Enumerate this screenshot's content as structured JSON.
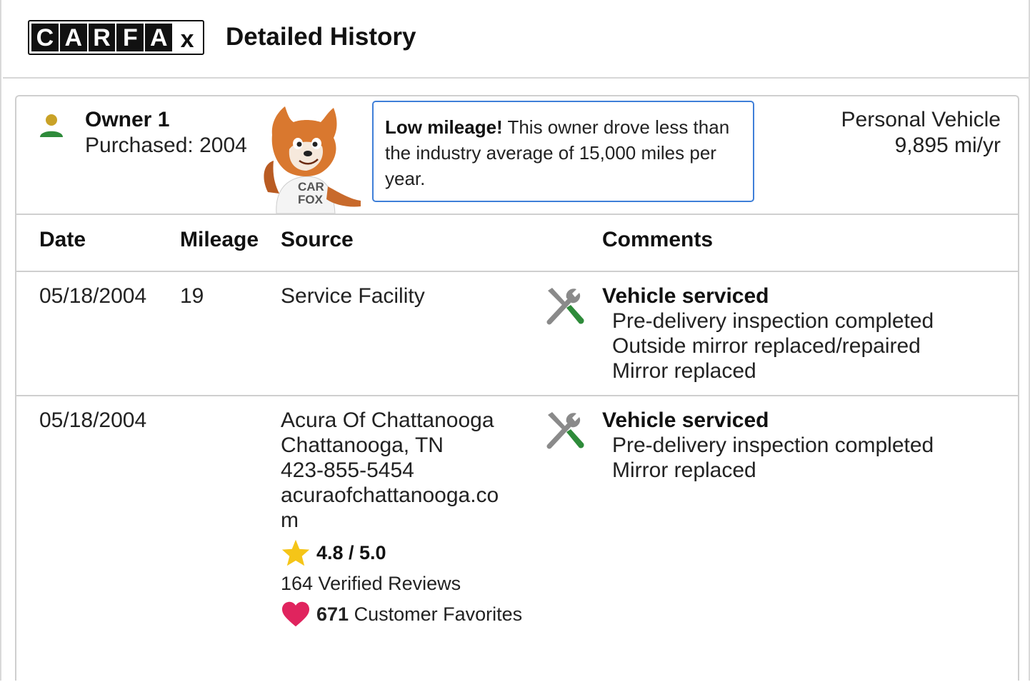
{
  "header": {
    "logo_letters": [
      "C",
      "A",
      "R",
      "F",
      "A",
      "x"
    ],
    "title": "Detailed History"
  },
  "owner": {
    "name": "Owner 1",
    "purchased": "Purchased: 2004",
    "mascot_shirt": [
      "CAR",
      "FOX"
    ],
    "callout_bold": "Low mileage!",
    "callout_text": " This owner drove less than the industry average of 15,000 miles per year.",
    "vehicle_type": "Personal Vehicle",
    "vehicle_miles": "9,895 mi/yr"
  },
  "table": {
    "headers": {
      "date": "Date",
      "mileage": "Mileage",
      "source": "Source",
      "comments": "Comments"
    },
    "rows": [
      {
        "date": "05/18/2004",
        "mileage": "19",
        "source_lines": [
          "Service Facility"
        ],
        "comment_title": "Vehicle serviced",
        "comment_lines": [
          "Pre-delivery inspection completed",
          "Outside mirror replaced/repaired",
          "Mirror replaced"
        ]
      },
      {
        "date": "05/18/2004",
        "mileage": "",
        "source_lines": [
          "Acura Of Chattanooga",
          "Chattanooga, TN",
          "423-855-5454",
          "acuraofchattanooga.co",
          "m"
        ],
        "rating": "4.8 / 5.0",
        "reviews": "164 Verified Reviews",
        "favorites_count": "671",
        "favorites_label": " Customer Favorites",
        "comment_title": "Vehicle serviced",
        "comment_lines": [
          "Pre-delivery inspection completed",
          "Mirror replaced"
        ]
      }
    ]
  },
  "colors": {
    "callout_border": "#3f7fd8",
    "wrench_gray": "#8a8a8a",
    "screwdriver_green": "#2e8b3a",
    "star_yellow": "#f5c518",
    "heart_pink": "#e0245e",
    "person_green": "#2e8b3a",
    "person_gold": "#c9a227"
  },
  "icons": [
    "person-icon",
    "tools-icon",
    "star-icon",
    "heart-icon"
  ]
}
